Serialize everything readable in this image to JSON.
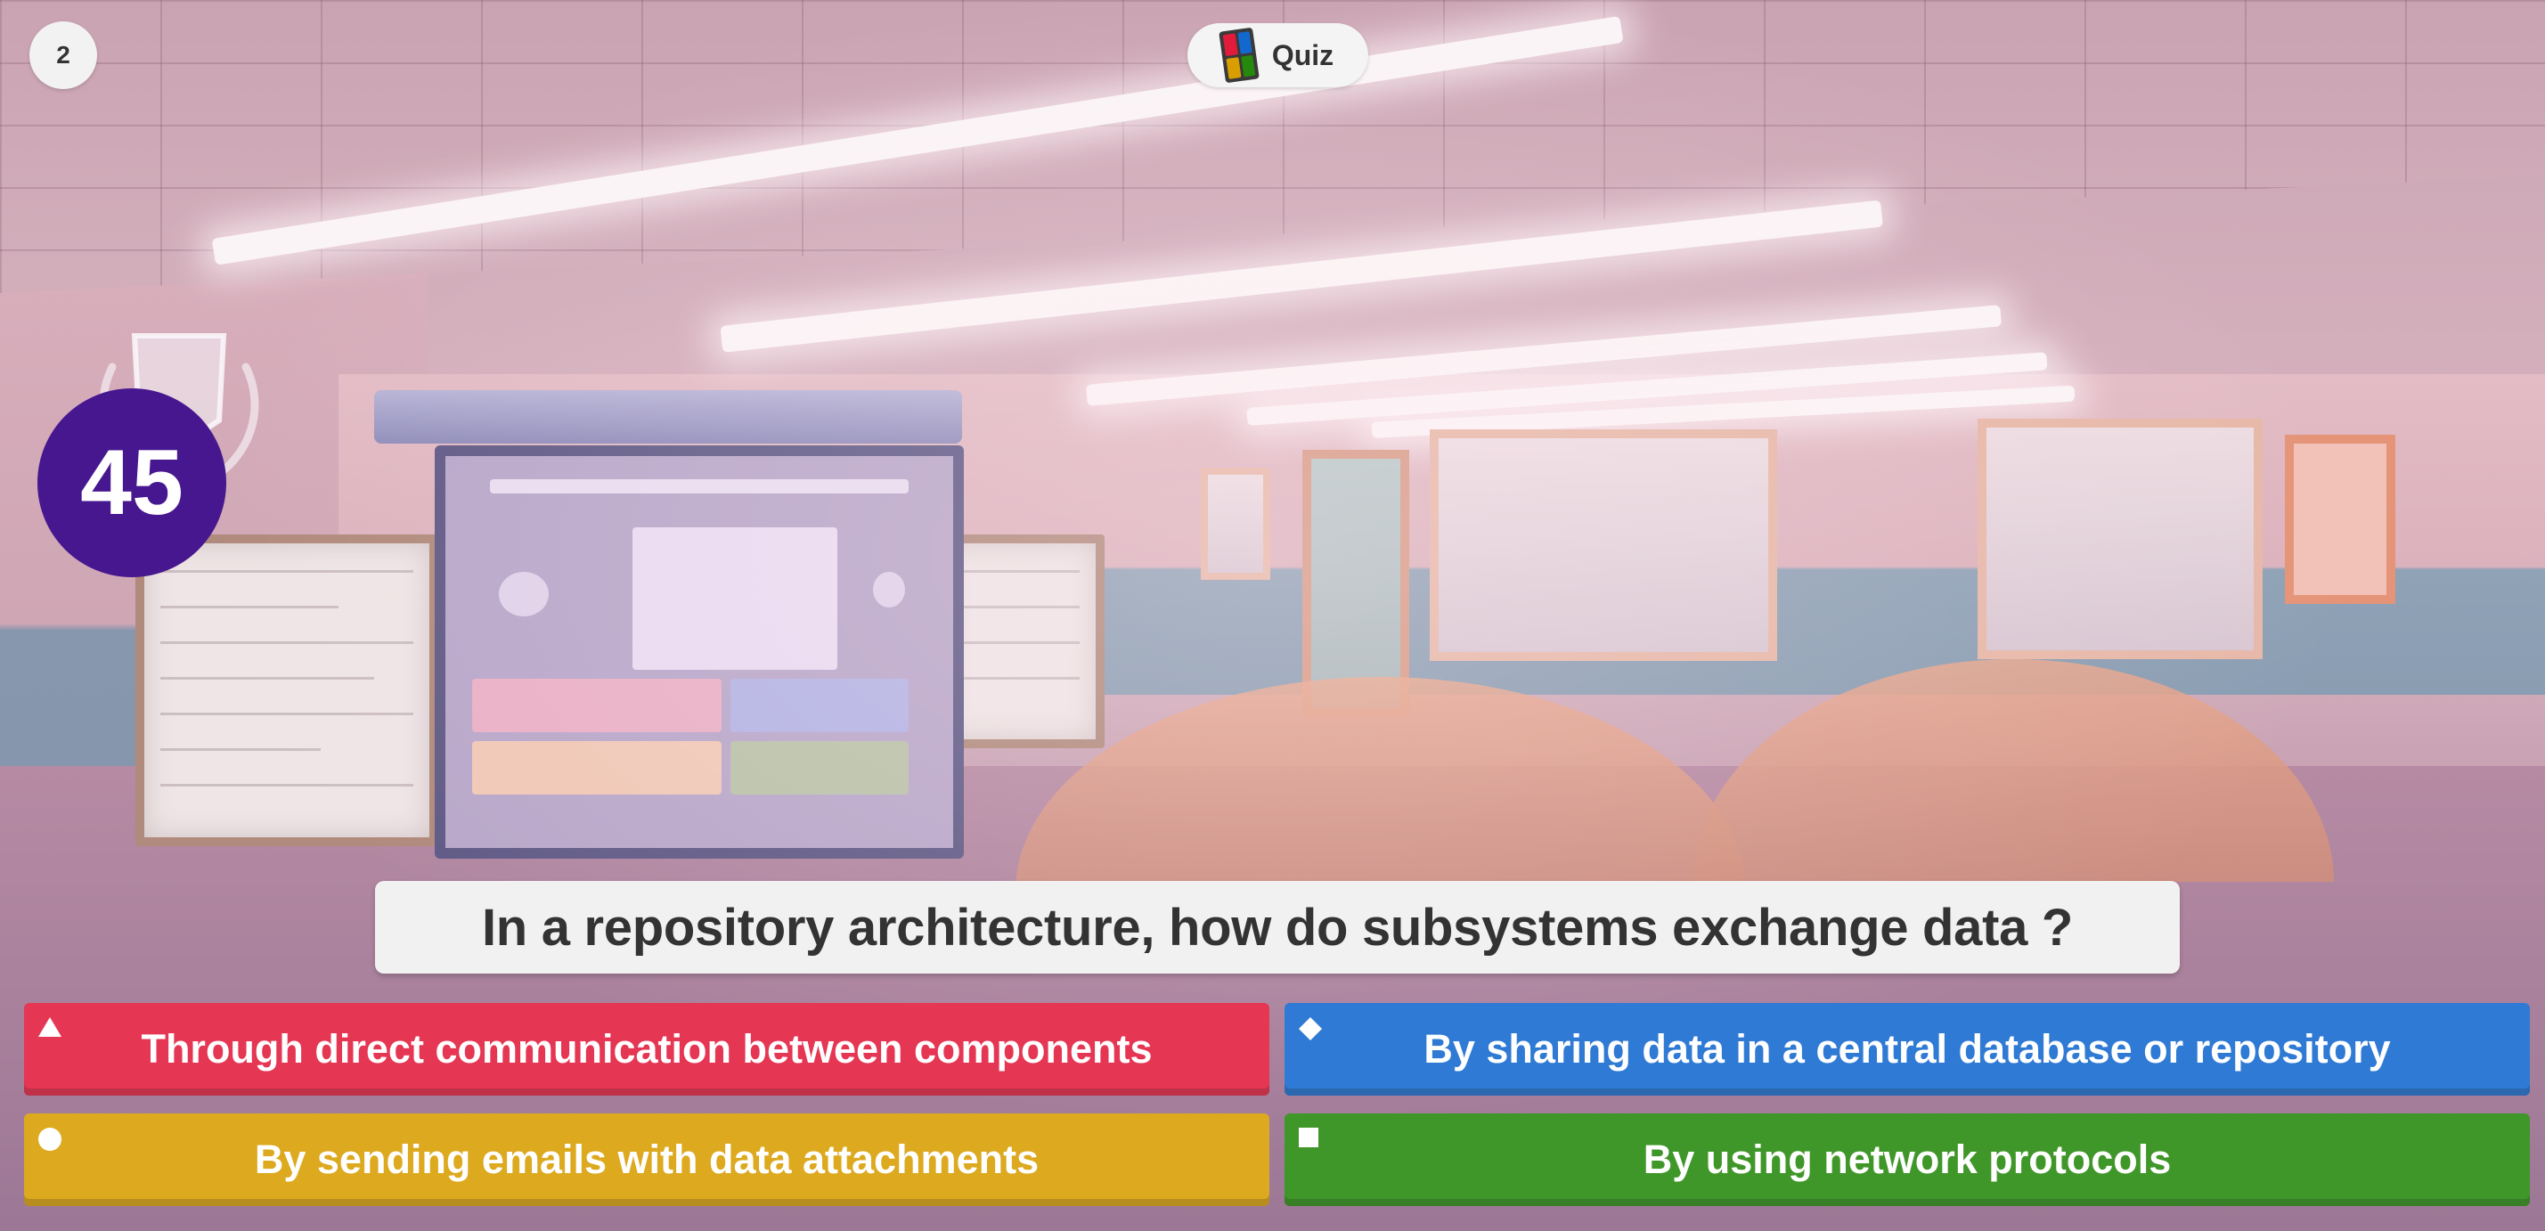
{
  "header": {
    "question_count": "2",
    "mode_label": "Quiz",
    "mode_icon": "quiz-grid-icon"
  },
  "timer": {
    "seconds_left": "45"
  },
  "question": {
    "text": "In a repository architecture, how do subsystems exchange data ?"
  },
  "answers": [
    {
      "label": "Through direct communication between components",
      "color": "#e21b3c",
      "shape": "triangle-icon"
    },
    {
      "label": "By sharing data in a central database or repository",
      "color": "#1368ce",
      "shape": "diamond-icon"
    },
    {
      "label": "By sending emails with data attachments",
      "color": "#d89e00",
      "shape": "circle-icon"
    },
    {
      "label": "By using network protocols",
      "color": "#26890c",
      "shape": "square-icon"
    }
  ],
  "colors": {
    "timer_bg": "#46178f",
    "question_bg": "#f2f1f1",
    "text_dark": "#333333"
  }
}
